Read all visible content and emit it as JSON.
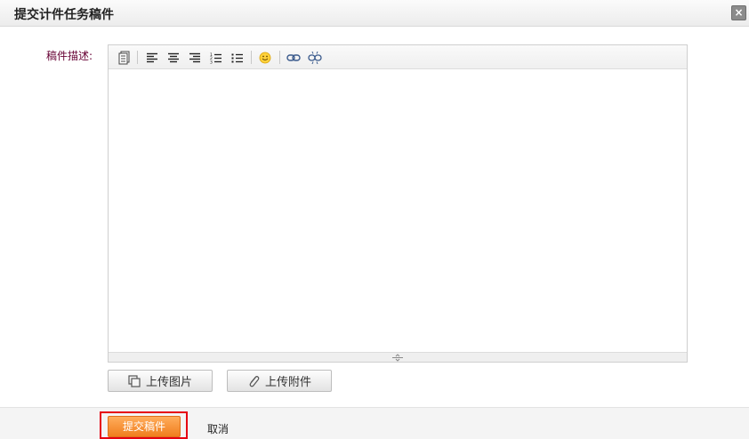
{
  "dialog": {
    "title": "提交计件任务稿件",
    "close_label": "×"
  },
  "form": {
    "description_label": "稿件描述:"
  },
  "editor": {
    "toolbar": [
      {
        "name": "source-icon",
        "tooltip": "HTML"
      },
      {
        "name": "align-left-icon"
      },
      {
        "name": "align-center-icon"
      },
      {
        "name": "align-right-icon"
      },
      {
        "name": "ordered-list-icon"
      },
      {
        "name": "unordered-list-icon"
      },
      {
        "name": "emoticon-icon"
      },
      {
        "name": "link-icon"
      },
      {
        "name": "unlink-icon"
      }
    ]
  },
  "uploads": {
    "image_label": "上传图片",
    "attachment_label": "上传附件"
  },
  "footer": {
    "submit_label": "提交稿件",
    "cancel_label": "取消"
  },
  "colors": {
    "label": "#660033",
    "submit": "#f07e1e",
    "highlight": "#e60012"
  }
}
